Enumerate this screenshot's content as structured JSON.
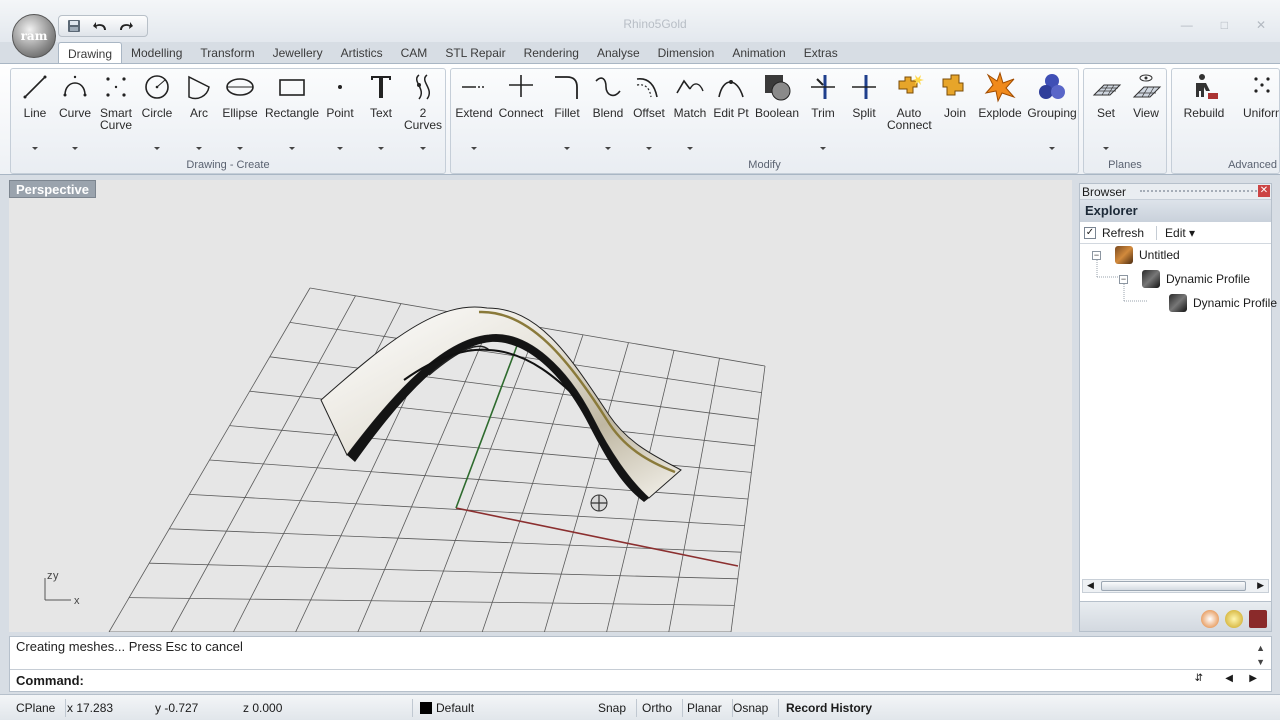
{
  "app": {
    "logo_text": "ram",
    "title": "Rhino5Gold",
    "qat": {
      "save_icon": "save-icon",
      "undo_icon": "undo-icon",
      "redo_icon": "redo-icon"
    }
  },
  "tabs": [
    {
      "label": "Drawing",
      "active": true
    },
    {
      "label": "Modelling"
    },
    {
      "label": "Transform"
    },
    {
      "label": "Jewellery"
    },
    {
      "label": "Artistics"
    },
    {
      "label": "CAM"
    },
    {
      "label": "STL Repair"
    },
    {
      "label": "Rendering"
    },
    {
      "label": "Analyse"
    },
    {
      "label": "Dimension"
    },
    {
      "label": "Animation"
    },
    {
      "label": "Extras"
    }
  ],
  "ribbon": {
    "drawing_group": {
      "label": "Drawing - Create",
      "tools": [
        {
          "line1": "Line",
          "line2": ""
        },
        {
          "line1": "Curve",
          "line2": ""
        },
        {
          "line1": "Smart",
          "line2": "Curve"
        },
        {
          "line1": "Circle",
          "line2": ""
        },
        {
          "line1": "Arc",
          "line2": ""
        },
        {
          "line1": "Ellipse",
          "line2": ""
        },
        {
          "line1": "Rectangle",
          "line2": ""
        },
        {
          "line1": "Point",
          "line2": ""
        },
        {
          "line1": "Text",
          "line2": ""
        },
        {
          "line1": "2",
          "line2": "Curves"
        }
      ]
    },
    "modify_group": {
      "label": "Modify",
      "tools": [
        {
          "line1": "Extend",
          "line2": ""
        },
        {
          "line1": "Connect",
          "line2": ""
        },
        {
          "line1": "Fillet",
          "line2": ""
        },
        {
          "line1": "Blend",
          "line2": ""
        },
        {
          "line1": "Offset",
          "line2": ""
        },
        {
          "line1": "Match",
          "line2": ""
        },
        {
          "line1": "Edit Pt",
          "line2": ""
        },
        {
          "line1": "Boolean",
          "line2": ""
        },
        {
          "line1": "Trim",
          "line2": ""
        },
        {
          "line1": "Split",
          "line2": ""
        },
        {
          "line1": "Auto",
          "line2": "Connect"
        },
        {
          "line1": "Join",
          "line2": ""
        },
        {
          "line1": "Explode",
          "line2": ""
        },
        {
          "line1": "Grouping",
          "line2": ""
        }
      ]
    },
    "planes_group": {
      "label": "Planes",
      "tools": [
        {
          "line1": "Set",
          "line2": ""
        },
        {
          "line1": "View",
          "line2": ""
        }
      ]
    },
    "advanced_group": {
      "label": "Advanced",
      "tools": [
        {
          "line1": "Rebuild",
          "line2": ""
        },
        {
          "line1": "Uniform",
          "line2": ""
        }
      ]
    }
  },
  "viewport": {
    "title": "Perspective",
    "axis_z": "z",
    "axis_y": "y",
    "axis_x": "x"
  },
  "browser": {
    "header": "Browser",
    "explorer_title": "Explorer",
    "refresh_label": "Refresh",
    "refresh_checked": true,
    "edit_label": "Edit",
    "tree": [
      {
        "label": "Untitled",
        "level": 0
      },
      {
        "label": "Dynamic Profile",
        "level": 1
      },
      {
        "label": "Dynamic Profile",
        "level": 2
      }
    ]
  },
  "command": {
    "history": "Creating meshes... Press Esc to cancel",
    "prompt_label": "Command:",
    "input_value": ""
  },
  "status": {
    "cplane": "CPlane",
    "x": "x 17.283",
    "y": "y -0.727",
    "z": "z 0.000",
    "layer": "Default",
    "snap": "Snap",
    "ortho": "Ortho",
    "planar": "Planar",
    "osnap": "Osnap",
    "record_history": "Record History"
  },
  "colors": {
    "grid_line": "#5a5a5a",
    "x_axis": "#8b2f2f",
    "y_axis": "#2e6b2e",
    "viewport_bg": "#e6e6e6"
  }
}
